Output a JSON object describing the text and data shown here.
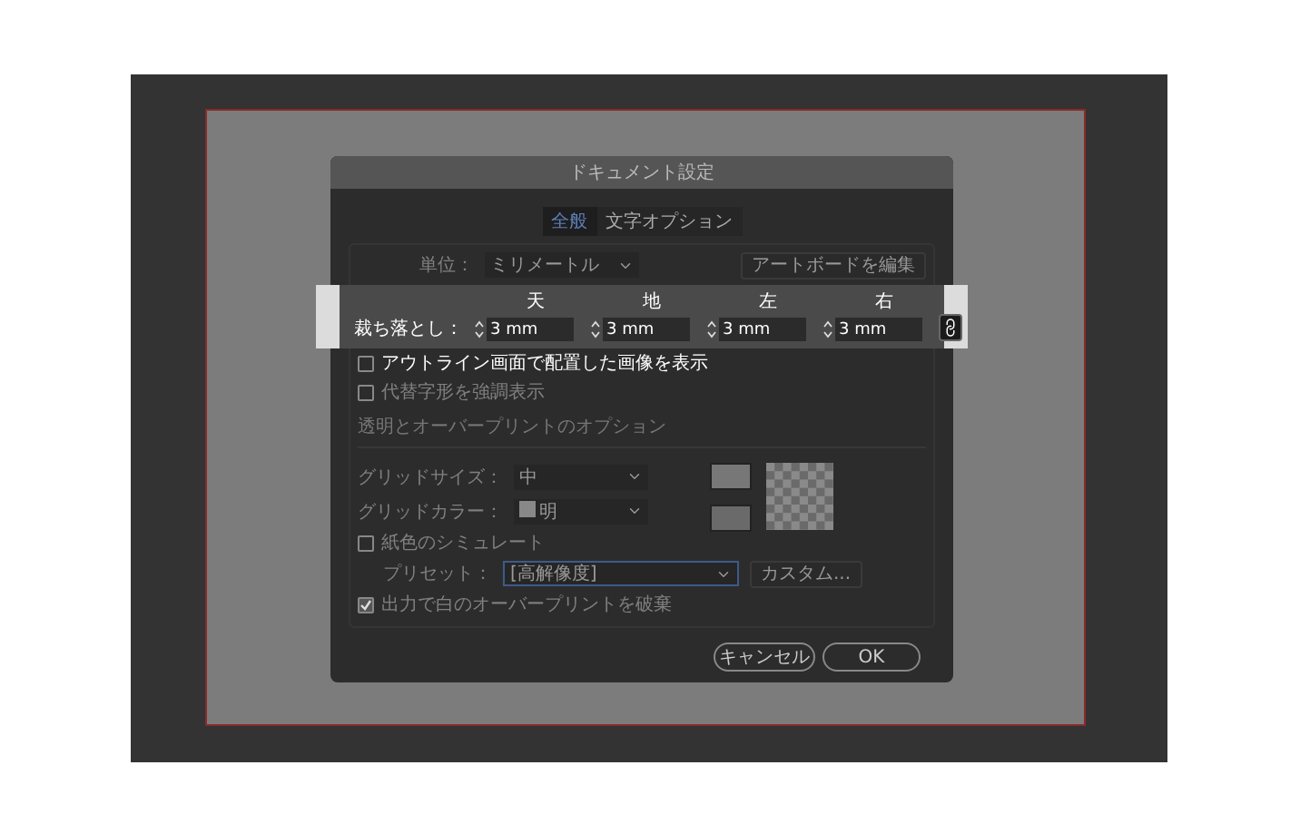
{
  "dialog": {
    "title": "ドキュメント設定",
    "tabs": [
      {
        "label": "全般",
        "selected": true
      },
      {
        "label": "文字オプション",
        "selected": false
      }
    ],
    "units": {
      "label": "単位：",
      "value": "ミリメートル"
    },
    "edit_artboard_button": "アートボードを編集",
    "bleed": {
      "label": "裁ち落とし：",
      "fields": [
        {
          "heading": "天",
          "value": "3 mm"
        },
        {
          "heading": "地",
          "value": "3 mm"
        },
        {
          "heading": "左",
          "value": "3 mm"
        },
        {
          "heading": "右",
          "value": "3 mm"
        }
      ]
    },
    "options": [
      {
        "label": "アウトライン画面で配置した画像を表示",
        "checked": false
      },
      {
        "label": "代替字形を強調表示",
        "checked": false
      }
    ],
    "transparency": {
      "title": "透明とオーバープリントのオプション",
      "grid_size": {
        "label": "グリッドサイズ：",
        "value": "中"
      },
      "grid_color": {
        "label": "グリッドカラー：",
        "value": "明"
      },
      "simulate_paper": {
        "label": "紙色のシミュレート",
        "checked": false
      },
      "preset": {
        "label": "プリセット：",
        "value": "[高解像度]"
      },
      "custom_button": "カスタム...",
      "discard_white_overprint": {
        "label": "出力で白のオーバープリントを破棄",
        "checked": true
      }
    },
    "buttons": [
      "キャンセル",
      "OK"
    ]
  }
}
